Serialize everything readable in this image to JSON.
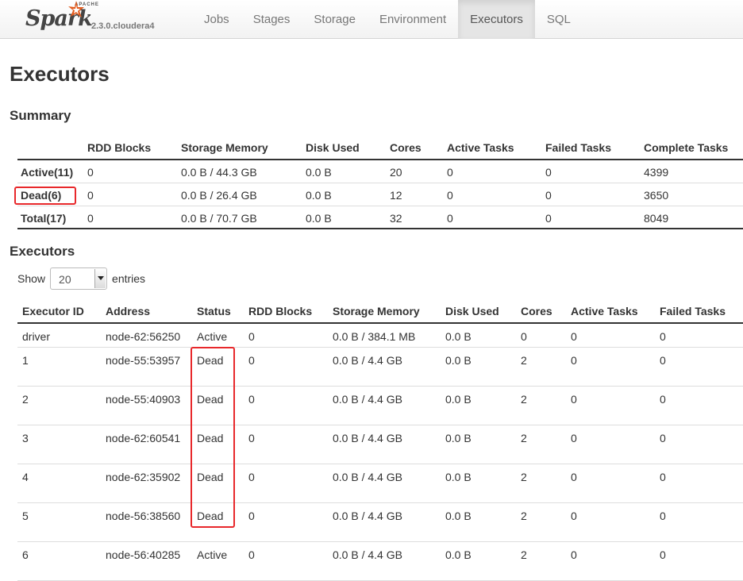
{
  "brand": {
    "apache": "APACHE",
    "name": "Spark",
    "version": "2.3.0.cloudera4"
  },
  "nav": [
    {
      "label": "Jobs"
    },
    {
      "label": "Stages"
    },
    {
      "label": "Storage"
    },
    {
      "label": "Environment"
    },
    {
      "label": "Executors",
      "active": true
    },
    {
      "label": "SQL"
    }
  ],
  "page": {
    "title": "Executors"
  },
  "summary": {
    "heading": "Summary",
    "columns": [
      "",
      "RDD Blocks",
      "Storage Memory",
      "Disk Used",
      "Cores",
      "Active Tasks",
      "Failed Tasks",
      "Complete Tasks"
    ],
    "rows": [
      [
        "Active(11)",
        "0",
        "0.0 B / 44.3 GB",
        "0.0 B",
        "20",
        "0",
        "0",
        "4399"
      ],
      [
        "Dead(6)",
        "0",
        "0.0 B / 26.4 GB",
        "0.0 B",
        "12",
        "0",
        "0",
        "3650"
      ],
      [
        "Total(17)",
        "0",
        "0.0 B / 70.7 GB",
        "0.0 B",
        "32",
        "0",
        "0",
        "8049"
      ]
    ]
  },
  "executors": {
    "heading": "Executors",
    "show_label": "Show",
    "entries_value": "20",
    "entries_label": "entries",
    "columns": [
      "Executor ID",
      "Address",
      "Status",
      "RDD Blocks",
      "Storage Memory",
      "Disk Used",
      "Cores",
      "Active Tasks",
      "Failed Tasks"
    ],
    "rows": [
      [
        "driver",
        "node-62:56250",
        "Active",
        "0",
        "0.0 B / 384.1 MB",
        "0.0 B",
        "0",
        "0",
        "0"
      ],
      [
        "1",
        "node-55:53957",
        "Dead",
        "0",
        "0.0 B / 4.4 GB",
        "0.0 B",
        "2",
        "0",
        "0"
      ],
      [
        "2",
        "node-55:40903",
        "Dead",
        "0",
        "0.0 B / 4.4 GB",
        "0.0 B",
        "2",
        "0",
        "0"
      ],
      [
        "3",
        "node-62:60541",
        "Dead",
        "0",
        "0.0 B / 4.4 GB",
        "0.0 B",
        "2",
        "0",
        "0"
      ],
      [
        "4",
        "node-62:35902",
        "Dead",
        "0",
        "0.0 B / 4.4 GB",
        "0.0 B",
        "2",
        "0",
        "0"
      ],
      [
        "5",
        "node-56:38560",
        "Dead",
        "0",
        "0.0 B / 4.4 GB",
        "0.0 B",
        "2",
        "0",
        "0"
      ],
      [
        "6",
        "node-56:40285",
        "Active",
        "0",
        "0.0 B / 4.4 GB",
        "0.0 B",
        "2",
        "0",
        "0"
      ]
    ]
  },
  "colors": {
    "highlight": "#e8282b",
    "spark_orange": "#e25a1c"
  }
}
